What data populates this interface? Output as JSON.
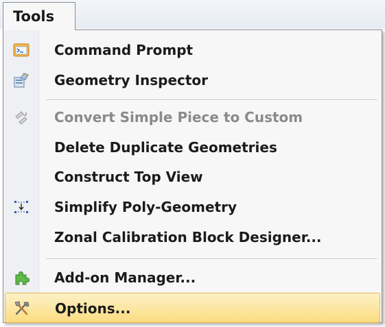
{
  "menu": {
    "title": "Tools",
    "items": [
      {
        "label": "Command Prompt",
        "icon": "command-prompt-icon",
        "enabled": true
      },
      {
        "label": "Geometry Inspector",
        "icon": "geometry-inspector-icon",
        "enabled": true
      },
      {
        "label": "Convert Simple Piece to Custom",
        "icon": "convert-piece-icon",
        "enabled": false
      },
      {
        "label": "Delete Duplicate Geometries",
        "icon": "",
        "enabled": true
      },
      {
        "label": "Construct Top View",
        "icon": "",
        "enabled": true
      },
      {
        "label": "Simplify Poly-Geometry",
        "icon": "simplify-geometry-icon",
        "enabled": true
      },
      {
        "label": "Zonal Calibration Block Designer...",
        "icon": "",
        "enabled": true
      },
      {
        "label": "Add-on Manager...",
        "icon": "puzzle-piece-icon",
        "enabled": true
      },
      {
        "label": "Options...",
        "icon": "tools-icon",
        "enabled": true,
        "highlighted": true
      }
    ]
  },
  "colors": {
    "highlight_top": "#fdf1c7",
    "highlight_bottom": "#fbdc80",
    "highlight_border": "#e5b84a",
    "disabled_text": "#8a8a8a"
  }
}
